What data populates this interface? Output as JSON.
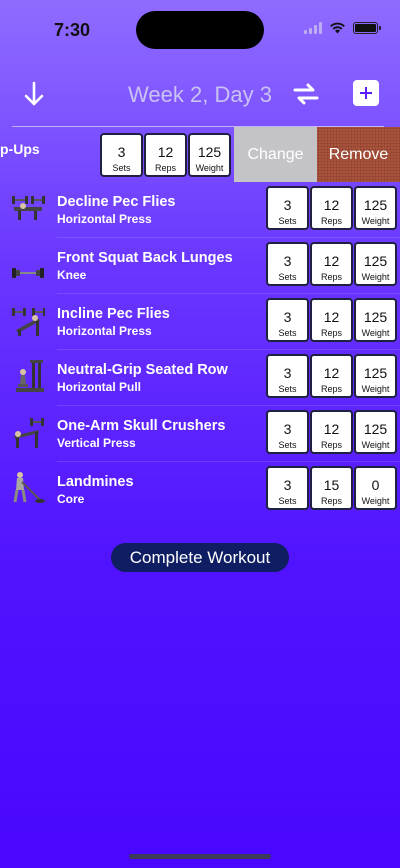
{
  "status_bar": {
    "time": "7:30"
  },
  "nav": {
    "title": "Week 2, Day 3"
  },
  "swiped_row": {
    "name": "p-Ups",
    "stats": [
      {
        "value": "3",
        "label": "Sets"
      },
      {
        "value": "12",
        "label": "Reps"
      },
      {
        "value": "125",
        "label": "Weight"
      }
    ],
    "change_label": "Change",
    "remove_label": "Remove"
  },
  "exercises": [
    {
      "name": "Decline Pec Flies",
      "category": "Horizontal Press",
      "icon": "dumbbell-bench-icon",
      "stats": [
        {
          "value": "3",
          "label": "Sets"
        },
        {
          "value": "12",
          "label": "Reps"
        },
        {
          "value": "125",
          "label": "Weight"
        }
      ]
    },
    {
      "name": "Front Squat Back Lunges",
      "category": "Knee",
      "icon": "dumbbell-icon",
      "stats": [
        {
          "value": "3",
          "label": "Sets"
        },
        {
          "value": "12",
          "label": "Reps"
        },
        {
          "value": "125",
          "label": "Weight"
        }
      ]
    },
    {
      "name": "Incline Pec Flies",
      "category": "Horizontal Press",
      "icon": "incline-bench-icon",
      "stats": [
        {
          "value": "3",
          "label": "Sets"
        },
        {
          "value": "12",
          "label": "Reps"
        },
        {
          "value": "125",
          "label": "Weight"
        }
      ]
    },
    {
      "name": "Neutral-Grip Seated Row",
      "category": "Horizontal Pull",
      "icon": "row-machine-icon",
      "stats": [
        {
          "value": "3",
          "label": "Sets"
        },
        {
          "value": "12",
          "label": "Reps"
        },
        {
          "value": "125",
          "label": "Weight"
        }
      ]
    },
    {
      "name": "One-Arm Skull Crushers",
      "category": "Vertical Press",
      "icon": "dumbbell-bench-icon",
      "stats": [
        {
          "value": "3",
          "label": "Sets"
        },
        {
          "value": "12",
          "label": "Reps"
        },
        {
          "value": "125",
          "label": "Weight"
        }
      ]
    },
    {
      "name": "Landmines",
      "category": "Core",
      "icon": "landmine-icon",
      "stats": [
        {
          "value": "3",
          "label": "Sets"
        },
        {
          "value": "15",
          "label": "Reps"
        },
        {
          "value": "0",
          "label": "Weight"
        }
      ]
    }
  ],
  "complete_label": "Complete Workout"
}
